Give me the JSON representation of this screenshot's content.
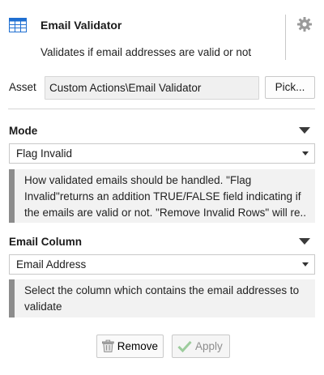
{
  "header": {
    "title": "Email Validator",
    "description": "Validates if email addresses are valid or not",
    "tool_icon": "grid-table-icon",
    "settings_icon": "gear-icon"
  },
  "asset": {
    "label": "Asset",
    "value": "Custom Actions\\Email Validator",
    "pick_label": "Pick..."
  },
  "mode": {
    "title": "Mode",
    "selected": "Flag Invalid",
    "help_lines": [
      "How validated emails should be handled. \"Flag",
      "Invalid\"returns an addition TRUE/FALSE field indicating if",
      "the emails are valid or not. \"Remove Invalid Rows\" will re..."
    ]
  },
  "email_column": {
    "title": "Email Column",
    "selected": "Email Address",
    "help_lines": [
      "Select the column which contains the email addresses to",
      "validate"
    ]
  },
  "buttons": {
    "remove_label": "Remove",
    "apply_label": "Apply"
  },
  "colors": {
    "accent_blue": "#1f6fd1",
    "apply_check_green": "#9ccc9c",
    "help_bar": "#8c8c8c"
  }
}
